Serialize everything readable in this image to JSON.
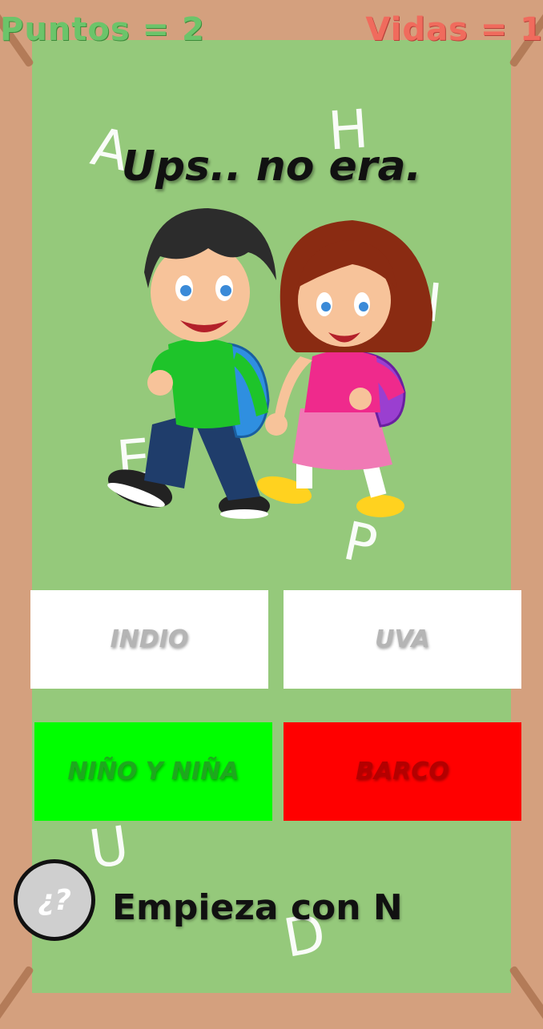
{
  "hud": {
    "score_label": "Puntos = 2",
    "lives_label": "Vidas = 1"
  },
  "feedback": "Ups.. no era.",
  "illustration_icon": "boy-and-girl-walking-icon",
  "background_letters": [
    "A",
    "H",
    "I",
    "E",
    "P",
    "U",
    "D"
  ],
  "options": [
    {
      "label": "INDIO",
      "state": "neutral",
      "color": "#ffffff"
    },
    {
      "label": "UVA",
      "state": "neutral",
      "color": "#ffffff"
    },
    {
      "label": "NIÑO Y NIÑA",
      "state": "correct",
      "color": "#00ff00"
    },
    {
      "label": "BARCO",
      "state": "wrong",
      "color": "#ff0000"
    }
  ],
  "hint": {
    "button_label": "¿?",
    "text": "Empieza con N"
  },
  "colors": {
    "frame": "#d4a07e",
    "board": "#95c97b",
    "score": "#6cc46a",
    "lives": "#f06b5d"
  }
}
